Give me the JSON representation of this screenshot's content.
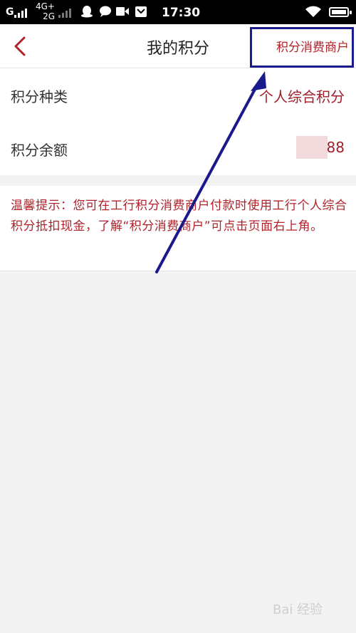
{
  "status_bar": {
    "carrier1": "G",
    "network_top": "4G+",
    "network_bottom": "2G",
    "time": "17:30"
  },
  "header": {
    "title": "我的积分",
    "merchant_link": "积分消费商户"
  },
  "rows": [
    {
      "label": "积分种类",
      "value": "个人综合积分"
    },
    {
      "label": "积分余额",
      "value": "88"
    }
  ],
  "tip": {
    "text": "温馨提示：您可在工行积分消费商户付款时使用工行个人综合积分抵扣现金，了解“积分消费商户”可点击页面右上角。"
  },
  "watermark": "Bai 经验",
  "colors": {
    "accent": "#b0222a",
    "annotation": "#1a1a8c"
  },
  "icons": [
    "signal-icon",
    "qq-icon",
    "message-icon",
    "video-icon",
    "mail-icon",
    "wifi-icon",
    "battery-icon",
    "back-arrow-icon"
  ]
}
